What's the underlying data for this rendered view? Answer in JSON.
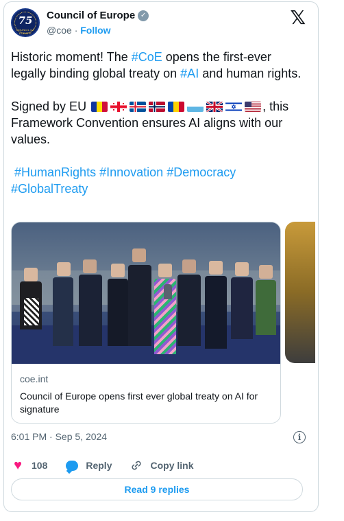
{
  "account": {
    "name": "Council of Europe",
    "handle": "@coe",
    "separator": "·",
    "follow_label": "Follow",
    "avatar_text": "75",
    "avatar_small_text": "COUNCIL OF EUROPE",
    "verified_icon": "verified-badge-icon"
  },
  "post": {
    "para1": {
      "t1": "Historic moment! The ",
      "tag1": "#CoE",
      "t2": " opens the first-ever legally binding global treaty on ",
      "tag2": "#AI",
      "t3": " and human rights."
    },
    "para2": {
      "t1": "Signed by EU ",
      "t2": ", this Framework Convention ensures AI aligns with our values.",
      "flags": [
        "andorra-flag",
        "georgia-flag",
        "iceland-flag",
        "norway-flag",
        "moldova-flag",
        "san-marino-flag",
        "uk-flag",
        "israel-flag",
        "us-flag"
      ]
    },
    "hashtags": [
      "#HumanRights",
      "#Innovation",
      "#Democracy",
      "#GlobalTreaty"
    ]
  },
  "link_card": {
    "domain": "coe.int",
    "title": "Council of Europe opens first ever global treaty on AI for signature"
  },
  "timestamp": "6:01 PM · Sep 5, 2024",
  "actions": {
    "likes": "108",
    "reply_label": "Reply",
    "copy_label": "Copy link"
  },
  "read_replies_label": "Read 9 replies",
  "colors": {
    "accent": "#1d9bf0",
    "like": "#f91880",
    "muted": "#536471",
    "text": "#0f1419",
    "border": "#cfd9de"
  }
}
